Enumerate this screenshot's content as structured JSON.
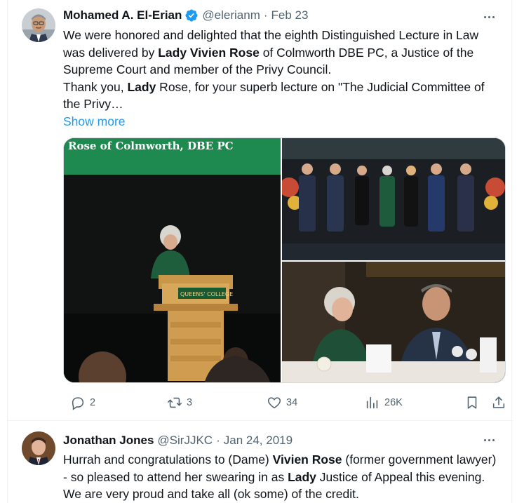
{
  "tweets": [
    {
      "author_name": "Mohamed A. El-Erian",
      "handle": "@elerianm",
      "separator": "·",
      "date": "Feb 23",
      "text_parts": {
        "p1": "We were honored and delighted that the eighth Distinguished Lecture in Law was delivered by ",
        "b1": "Lady Vivien Rose",
        "p2": " of Colmworth DBE PC, a Justice of the Supreme Court and member of the Privy Council.",
        "p3": "Thank you, ",
        "b2": "Lady",
        "p4": " Rose, for your superb lecture on \"The Judicial Committee of the Privy…"
      },
      "show_more": "Show more",
      "media": {
        "left_banner_text": "Rose of Colmworth, DBE PC",
        "podium_text": "QUEENS' COLLEGE"
      },
      "actions": {
        "reply_count": "2",
        "retweet_count": "3",
        "like_count": "34",
        "views_count": "26K"
      }
    },
    {
      "author_name": "Jonathan Jones",
      "handle": "@SirJJKC",
      "separator": "·",
      "date": "Jan 24, 2019",
      "text_parts": {
        "p1": "Hurrah and congratulations to (Dame) ",
        "b1": "Vivien Rose",
        "p2": " (former government lawyer) - so pleased to attend her swearing in as ",
        "b2": "Lady",
        "p3": " Justice of Appeal this evening.  We are very proud and take all (ok some) of the credit."
      }
    }
  ],
  "colors": {
    "accent": "#1d9bf0",
    "secondary_text": "#536471",
    "border": "#eff3f4"
  },
  "icons": {
    "verified": "verified-badge-icon",
    "more": "more-icon",
    "reply": "reply-icon",
    "retweet": "retweet-icon",
    "like": "heart-icon",
    "views": "views-icon",
    "bookmark": "bookmark-icon",
    "share": "share-icon"
  }
}
